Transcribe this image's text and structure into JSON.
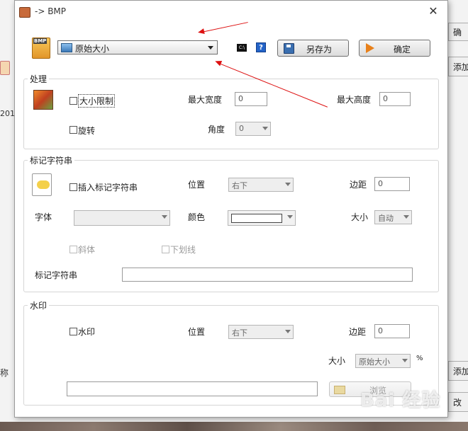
{
  "window": {
    "title": "-> BMP"
  },
  "toolbar": {
    "size_mode": "原始大小",
    "save_as_label": "另存为",
    "ok_label": "确定",
    "cmd_icon_text": "C:\\",
    "help_text": "?"
  },
  "process": {
    "title": "处理",
    "size_limit_label": "大小限制",
    "max_width_label": "最大宽度",
    "max_width_value": "0",
    "max_height_label": "最大高度",
    "max_height_value": "0",
    "rotate_label": "旋转",
    "angle_label": "角度",
    "angle_value": "0"
  },
  "mark": {
    "title": "标记字符串",
    "insert_label": "插入标记字符串",
    "position_label": "位置",
    "position_value": "右下",
    "margin_label": "边距",
    "margin_value": "0",
    "font_label": "字体",
    "font_value": "",
    "color_label": "颜色",
    "size_label": "大小",
    "size_value": "自动",
    "italic_label": "斜体",
    "underline_label": "下划线",
    "string_label": "标记字符串",
    "string_value": ""
  },
  "watermark": {
    "title": "水印",
    "enable_label": "水印",
    "position_label": "位置",
    "position_value": "右下",
    "margin_label": "边距",
    "margin_value": "0",
    "size_label": "大小",
    "size_value": "原始大小",
    "percent": "%",
    "path_value": "",
    "browse_label": "浏览"
  },
  "background": {
    "right_top_btn": "确",
    "right_add_btn": "添加",
    "left_text_2017": "201",
    "left_text_name": "称",
    "right_add_btn2": "添加文",
    "right_change_btn": "改"
  },
  "watermark_overlay": "Bai 经验",
  "colors": {
    "annotation_red": "#d11111",
    "title_icon": "#c86a3a"
  }
}
